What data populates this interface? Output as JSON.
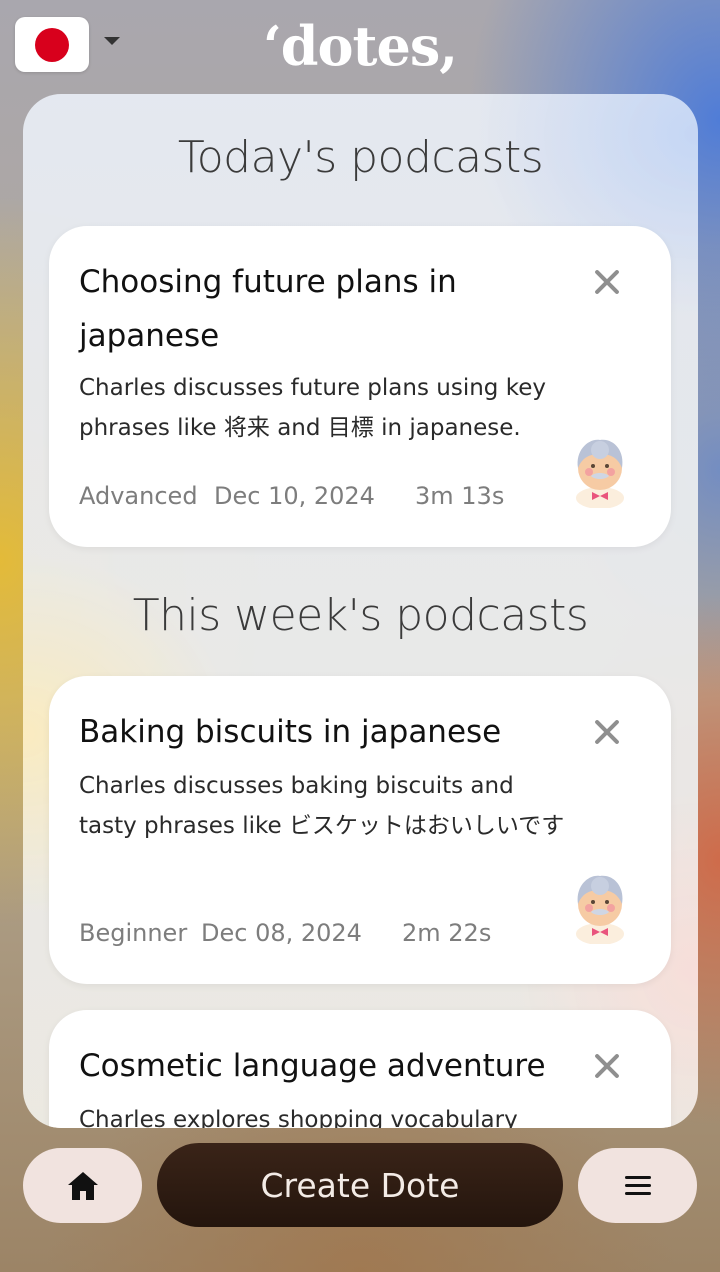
{
  "header": {
    "language_flag": "japan-flag",
    "logo": "‘dotes,"
  },
  "sections": {
    "today_title": "Today's podcasts",
    "week_title": "This week's podcasts"
  },
  "cards": [
    {
      "title": "Choosing future plans in japanese",
      "description": "Charles discusses future plans using key phrases like 将来 and 目標 in japanese.",
      "level": "Advanced",
      "date": "Dec 10, 2024",
      "duration": "3m 13s"
    },
    {
      "title": "Baking biscuits in japanese",
      "description": "Charles discusses baking biscuits and tasty phrases like ビスケットはおいしいです",
      "level": "Beginner",
      "date": "Dec 08, 2024",
      "duration": "2m 22s"
    },
    {
      "title": "Cosmetic language adventure",
      "description": "Charles explores shopping vocabulary"
    }
  ],
  "bottom_bar": {
    "create_label": "Create Dote",
    "home_icon": "home-icon",
    "menu_icon": "menu-icon"
  },
  "colors": {
    "flag_red": "#d8001c",
    "create_button": "#2b190f",
    "pill_buttons": "#f1e3df"
  }
}
